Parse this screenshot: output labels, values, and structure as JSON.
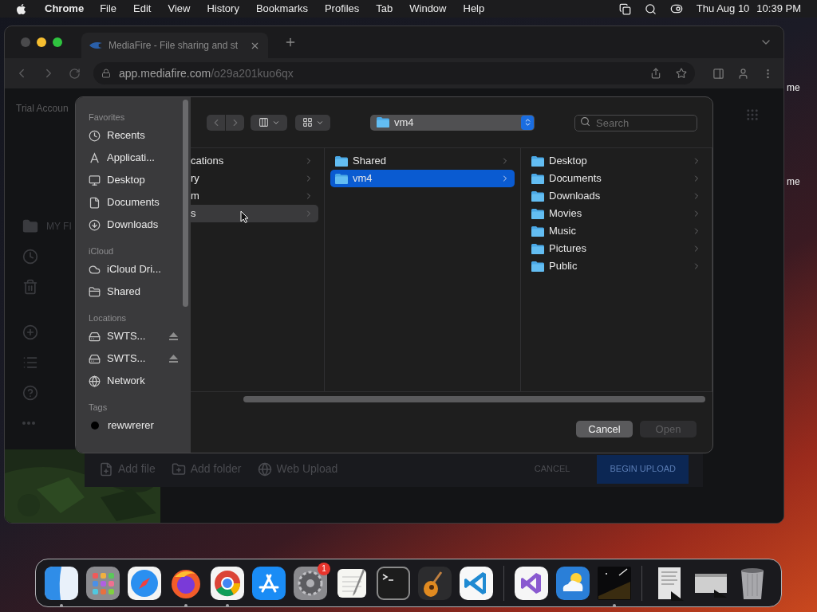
{
  "menubar": {
    "app": "Chrome",
    "menus": [
      "File",
      "Edit",
      "View",
      "History",
      "Bookmarks",
      "Profiles",
      "Tab",
      "Window",
      "Help"
    ],
    "date": "Thu Aug 10",
    "time": "10:39 PM"
  },
  "browser": {
    "tab_title": "MediaFire - File sharing and st",
    "address": {
      "host": "app.mediafire.com",
      "path": "/o29a201kuo6qx"
    }
  },
  "page": {
    "account_title": "Trial Accoun",
    "nav": [
      {
        "kind": "folder",
        "label": "MY FI"
      },
      {
        "kind": "recent"
      },
      {
        "kind": "trash"
      },
      {
        "kind": "add"
      },
      {
        "kind": "list"
      },
      {
        "kind": "help"
      },
      {
        "kind": "more"
      }
    ],
    "upload_actions": [
      {
        "kind": "file",
        "label": "Add file"
      },
      {
        "kind": "folder",
        "label": "Add folder"
      },
      {
        "kind": "web",
        "label": "Web Upload"
      }
    ],
    "cancel": "CANCEL",
    "begin_upload": "BEGIN UPLOAD"
  },
  "desktop_labels": [
    "me",
    "me"
  ],
  "dialog": {
    "sidebar": [
      {
        "title": "Favorites",
        "items": [
          {
            "kind": "recents",
            "label": "Recents"
          },
          {
            "kind": "applications",
            "label": "Applicati..."
          },
          {
            "kind": "desktop",
            "label": "Desktop"
          },
          {
            "kind": "documents",
            "label": "Documents"
          },
          {
            "kind": "downloads",
            "label": "Downloads"
          }
        ]
      },
      {
        "title": "iCloud",
        "items": [
          {
            "kind": "icloud",
            "label": "iCloud Dri..."
          },
          {
            "kind": "shared",
            "label": "Shared"
          }
        ]
      },
      {
        "title": "Locations",
        "items": [
          {
            "kind": "volume",
            "label": "SWTS..."
          },
          {
            "kind": "volume",
            "label": "SWTS..."
          },
          {
            "kind": "network",
            "label": "Network"
          }
        ]
      },
      {
        "title": "Tags",
        "items": [
          {
            "kind": "tag",
            "label": "rewwrerer",
            "color": "#000000"
          }
        ]
      }
    ],
    "location": "vm4",
    "search": {
      "placeholder": "Search"
    },
    "columns": [
      {
        "kind": "clipped",
        "items": [
          {
            "label": "cations",
            "selected": false
          },
          {
            "label": "ry",
            "selected": false
          },
          {
            "label": "m",
            "selected": false
          },
          {
            "label": "s",
            "selected": true
          }
        ]
      },
      {
        "kind": "folders",
        "items": [
          {
            "label": "Shared",
            "selected": false
          },
          {
            "label": "vm4",
            "selected": true
          }
        ]
      },
      {
        "kind": "folders",
        "items": [
          {
            "label": "Desktop",
            "selected": false
          },
          {
            "label": "Documents",
            "selected": false
          },
          {
            "label": "Downloads",
            "selected": false
          },
          {
            "label": "Movies",
            "selected": false
          },
          {
            "label": "Music",
            "selected": false
          },
          {
            "label": "Pictures",
            "selected": false
          },
          {
            "label": "Public",
            "selected": false
          }
        ]
      }
    ],
    "buttons": [
      {
        "label": "Cancel",
        "disabled": false
      },
      {
        "label": "Open",
        "disabled": true
      }
    ]
  },
  "dock": {
    "sections": [
      [
        {
          "kind": "finder",
          "running": true
        },
        {
          "kind": "launchpad",
          "running": false
        },
        {
          "kind": "safari",
          "running": false
        },
        {
          "kind": "firefox",
          "running": true
        },
        {
          "kind": "chrome",
          "running": true
        },
        {
          "kind": "appstore",
          "running": false
        },
        {
          "kind": "settings",
          "running": false,
          "badge": "1"
        },
        {
          "kind": "textedit",
          "running": false
        },
        {
          "kind": "terminal",
          "running": false
        },
        {
          "kind": "guitar",
          "running": false
        },
        {
          "kind": "vscode",
          "running": false
        }
      ],
      [
        {
          "kind": "visualstudio",
          "running": false
        },
        {
          "kind": "weather",
          "running": false
        },
        {
          "kind": "nightsky",
          "running": true
        }
      ],
      [
        {
          "kind": "docthumb",
          "running": false
        },
        {
          "kind": "windowthumb",
          "running": false
        },
        {
          "kind": "trash",
          "running": false
        }
      ]
    ]
  }
}
